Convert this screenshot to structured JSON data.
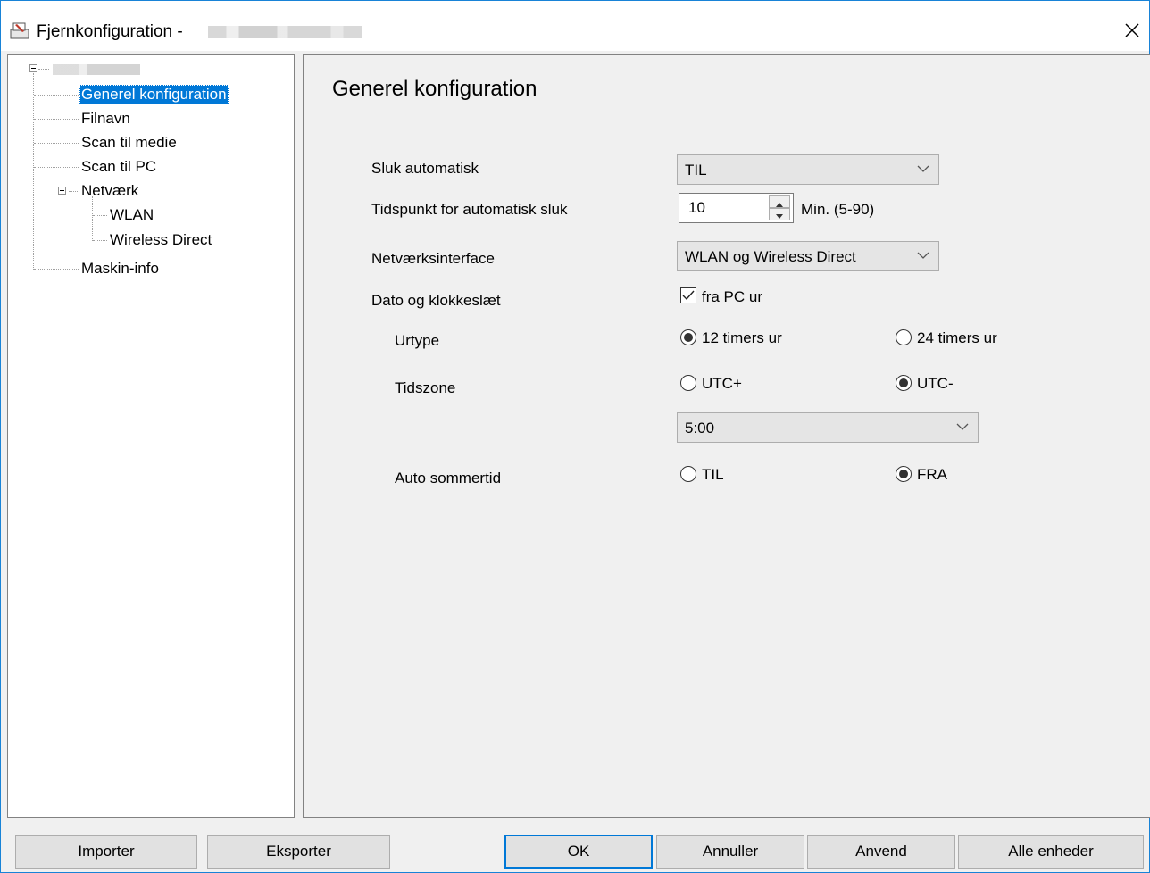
{
  "window": {
    "title": "Fjernkonfiguration -"
  },
  "tree": {
    "items": [
      {
        "label": "Generel konfiguration"
      },
      {
        "label": "Filnavn"
      },
      {
        "label": "Scan til medie"
      },
      {
        "label": "Scan til PC"
      },
      {
        "label": "Netværk"
      },
      {
        "label": "WLAN"
      },
      {
        "label": "Wireless Direct"
      },
      {
        "label": "Maskin-info"
      }
    ]
  },
  "main": {
    "heading": "Generel konfiguration",
    "auto_off": {
      "label": "Sluk automatisk",
      "value": "TIL"
    },
    "auto_off_time": {
      "label": "Tidspunkt for automatisk sluk",
      "value": "10",
      "unit": "Min. (5-90)"
    },
    "network_interface": {
      "label": "Netværksinterface",
      "value": "WLAN og Wireless Direct"
    },
    "date_time": {
      "label": "Dato og klokkeslæt",
      "checkbox_label": "fra PC ur",
      "checked": true
    },
    "clock_type": {
      "label": "Urtype",
      "option1": "12 timers ur",
      "option2": "24 timers ur",
      "selected": "12 timers ur"
    },
    "timezone": {
      "label": "Tidszone",
      "option1": "UTC+",
      "option2": "UTC-",
      "selected": "UTC-",
      "value": "5:00"
    },
    "dst": {
      "label": "Auto sommertid",
      "option1": "TIL",
      "option2": "FRA",
      "selected": "FRA"
    }
  },
  "buttons": {
    "import": "Importer",
    "export": "Eksporter",
    "ok": "OK",
    "cancel": "Annuller",
    "apply": "Anvend",
    "all_devices": "Alle enheder"
  },
  "colors": {
    "selection": "#0078d7",
    "window_border": "#1883d7",
    "background": "#f0f0f0"
  }
}
